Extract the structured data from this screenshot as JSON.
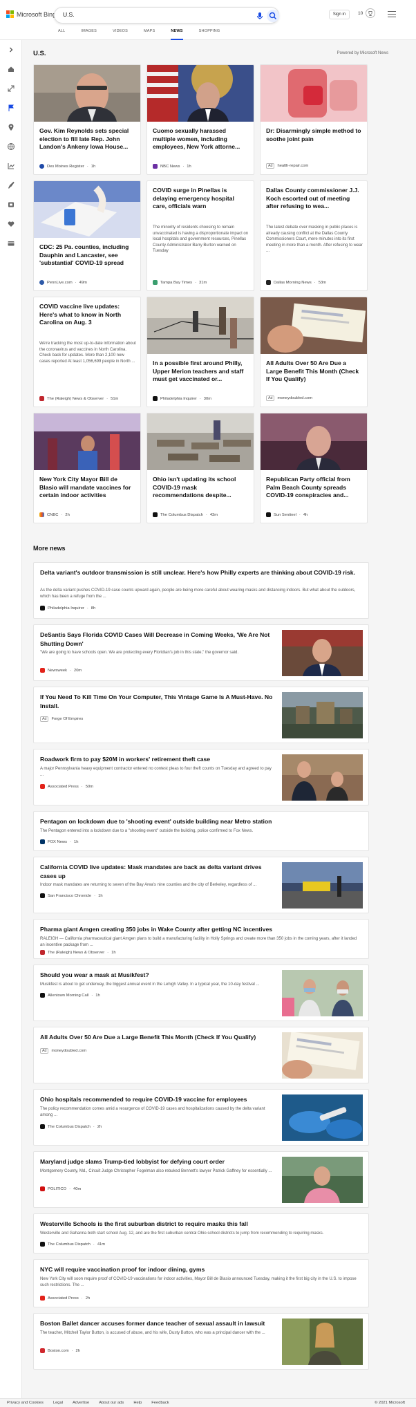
{
  "brand": {
    "logo_text": "Microsoft Bing",
    "logo_colors": [
      "#f25022",
      "#7fba00",
      "#00a4ef",
      "#ffb900"
    ]
  },
  "search": {
    "query": "U.S."
  },
  "header": {
    "signin_label": "Sign in",
    "points": "10"
  },
  "tabs": [
    {
      "label": "ALL"
    },
    {
      "label": "IMAGES"
    },
    {
      "label": "VIDEOS"
    },
    {
      "label": "MAPS"
    },
    {
      "label": "NEWS",
      "active": true
    },
    {
      "label": "SHOPPING"
    }
  ],
  "sidebar_icons": [
    "chevron-right-icon",
    "home-icon",
    "expand-icon",
    "flag-icon",
    "location-pin-icon",
    "globe-icon",
    "chart-icon",
    "rocket-icon",
    "film-icon",
    "heart-icon",
    "card-icon"
  ],
  "page": {
    "title": "U.S.",
    "powered_by": "Powered by Microsoft News"
  },
  "cards": [
    {
      "title": "Gov. Kim Reynolds sets special election to fill late Rep. John Landon's Ankeny Iowa House...",
      "source": "Des Moines Register",
      "time": "1h"
    },
    {
      "title": "Cuomo sexually harassed multiple women, including employees, New York attorne...",
      "source": "NBC News",
      "time": "1h"
    },
    {
      "title": "Dr: Disarmingly simple method to soothe joint pain",
      "ad": "Ad",
      "source": "health-repair.com"
    },
    {
      "title": "CDC: 25 Pa. counties, including Dauphin and Lancaster, see 'substantial' COVID-19 spread",
      "source": "PennLive.com",
      "time": "49m"
    },
    {
      "title": "COVID surge in Pinellas is delaying emergency hospital care, officials warn",
      "desc": "The minority of residents choosing to remain unvaccinated is having a disproportionate impact on local hospitals and government resources, Pinellas County Administrator Barry Burton warned on Tuesday",
      "source": "Tampa Bay Times",
      "time": "31m"
    },
    {
      "title": "Dallas County commissioner J.J. Koch escorted out of meeting after refusing to wea...",
      "desc": "The latest debate over masking in public places is already causing conflict at the Dallas County Commissioners Court, mere minutes into its first meeting in more than a month. After refusing to wear ...",
      "source": "Dallas Morning News",
      "time": "53m"
    },
    {
      "title": "COVID vaccine live updates: Here's what to know in North Carolina on Aug. 3",
      "desc": "We're tracking the most up-to-date information about the coronavirus and vaccines in North Carolina. Check back for updates. More than 2,100 new cases reported At least 1,056,699 people in North ...",
      "source": "The (Raleigh) News & Observer",
      "time": "51m"
    },
    {
      "title": "In a possible first around Philly, Upper Merion teachers and staff must get vaccinated or...",
      "source": "Philadelphia Inquirer",
      "time": "30m"
    },
    {
      "title": "All Adults Over 50 Are Due a Large Benefit This Month (Check If You Qualify)",
      "ad": "Ad",
      "source": "moneydoubled.com"
    },
    {
      "title": "New York City Mayor Bill de Blasio will mandate vaccines for certain indoor activities",
      "source": "CNBC",
      "time": "2h"
    },
    {
      "title": "Ohio isn't updating its school COVID-19 mask recommendations despite...",
      "source": "The Columbus Dispatch",
      "time": "43m"
    },
    {
      "title": "Republican Party official from Palm Beach County spreads COVID-19 conspiracies and...",
      "source": "Sun Sentinel",
      "time": "4h"
    }
  ],
  "more_news": {
    "title": "More news",
    "items": [
      {
        "title": "Delta variant's outdoor transmission is still unclear. Here's how Philly experts are thinking about COVID-19 risk.",
        "snippet": "As the delta variant pushes COVID-19 case counts upward again, people are being more careful about wearing masks and distancing indoors. But what about the outdoors, which has been a refuge from the ...",
        "source": "Philadelphia Inquirer",
        "time": "8h"
      },
      {
        "title": "DeSantis Says Florida COVID Cases Will Decrease in Coming Weeks, 'We Are Not Shutting Down'",
        "snippet": "\"We are going to have schools open. We are protecting every Floridian's job in this state,\" the governor said.",
        "source": "Newsweek",
        "time": "20m"
      },
      {
        "title": "If You Need To Kill Time On Your Computer, This Vintage Game Is A Must-Have. No Install.",
        "ad": "Ad",
        "source": "Forge Of Empires"
      },
      {
        "title": "Roadwork firm to pay $20M in workers' retirement theft case",
        "snippet": "A major Pennsylvania heavy equipment contractor entered no contest pleas to four theft counts on Tuesday and agreed to pay ...",
        "source": "Associated Press",
        "time": "50m"
      },
      {
        "title": "Pentagon on lockdown due to 'shooting event' outside building near Metro station",
        "snippet": "The Pentagon entered into a lockdown due to a \"shooting event\" outside the building, police confirmed to Fox News.",
        "source": "FOX News",
        "time": "1h"
      },
      {
        "title": "California COVID live updates: Mask mandates are back as delta variant drives cases up",
        "snippet": "Indoor mask mandates are returning to seven of the Bay Area's nine counties and the city of Berkeley, regardless of ...",
        "source": "San Francisco Chronicle",
        "time": "1h"
      },
      {
        "title": "Pharma giant Amgen creating 350 jobs in Wake County after getting NC incentives",
        "snippet": "RALEIGH — California pharmaceutical giant Amgen plans to build a manufacturing facility in Holly Springs and create more than 350 jobs in the coming years, after it landed an incentive package from ...",
        "source": "The (Raleigh) News & Observer",
        "time": "1h"
      },
      {
        "title": "Should you wear a mask at Musikfest?",
        "snippet": "Musikfest is about to get underway, the biggest annual event in the Lehigh Valley. In a typical year, the 10-day festival ...",
        "source": "Allentown Morning Call",
        "time": "1h"
      },
      {
        "title": "All Adults Over 50 Are Due a Large Benefit This Month (Check If You Qualify)",
        "ad": "Ad",
        "source": "moneydoubled.com"
      },
      {
        "title": "Ohio hospitals recommended to require COVID-19 vaccine for employees",
        "snippet": "The policy recommendation comes amid a resurgence of COVID-19 cases and hospitalizations caused by the delta variant among ...",
        "source": "The Columbus Dispatch",
        "time": "2h"
      },
      {
        "title": "Maryland judge slams Trump-tied lobbyist for defying court order",
        "snippet": "Montgomery County, Md., Circuit Judge Christopher Fogelman also rebuked Bennett's lawyer Patrick Gaffney for essentially ...",
        "source": "POLITICO",
        "time": "40m"
      },
      {
        "title": "Westerville Schools is the first suburban district to require masks this fall",
        "snippet": "Westerville and Gahanna both start school Aug. 12, and are the first suburban central Ohio school districts to jump from recommending to requiring masks.",
        "source": "The Columbus Dispatch",
        "time": "41m"
      },
      {
        "title": "NYC will require vaccination proof for indoor dining, gyms",
        "snippet": "New York City will soon require proof of COVID-19 vaccinations for indoor activities, Mayor Bill de Blasio announced Tuesday, making it the first big city in the U.S. to impose such restrictions. The ...",
        "source": "Associated Press",
        "time": "2h"
      },
      {
        "title": "Boston Ballet dancer accuses former dance teacher of sexual assault in lawsuit",
        "snippet": "The teacher, Mitchell Taylor Button, is accused of abuse, and his wife, Dusty Button, who was a principal dancer with the ...",
        "source": "Boston.com",
        "time": "2h"
      }
    ]
  },
  "footer": {
    "links": [
      "Privacy and Cookies",
      "Legal",
      "Advertise",
      "About our ads",
      "Help",
      "Feedback"
    ],
    "copyright": "© 2021 Microsoft"
  }
}
